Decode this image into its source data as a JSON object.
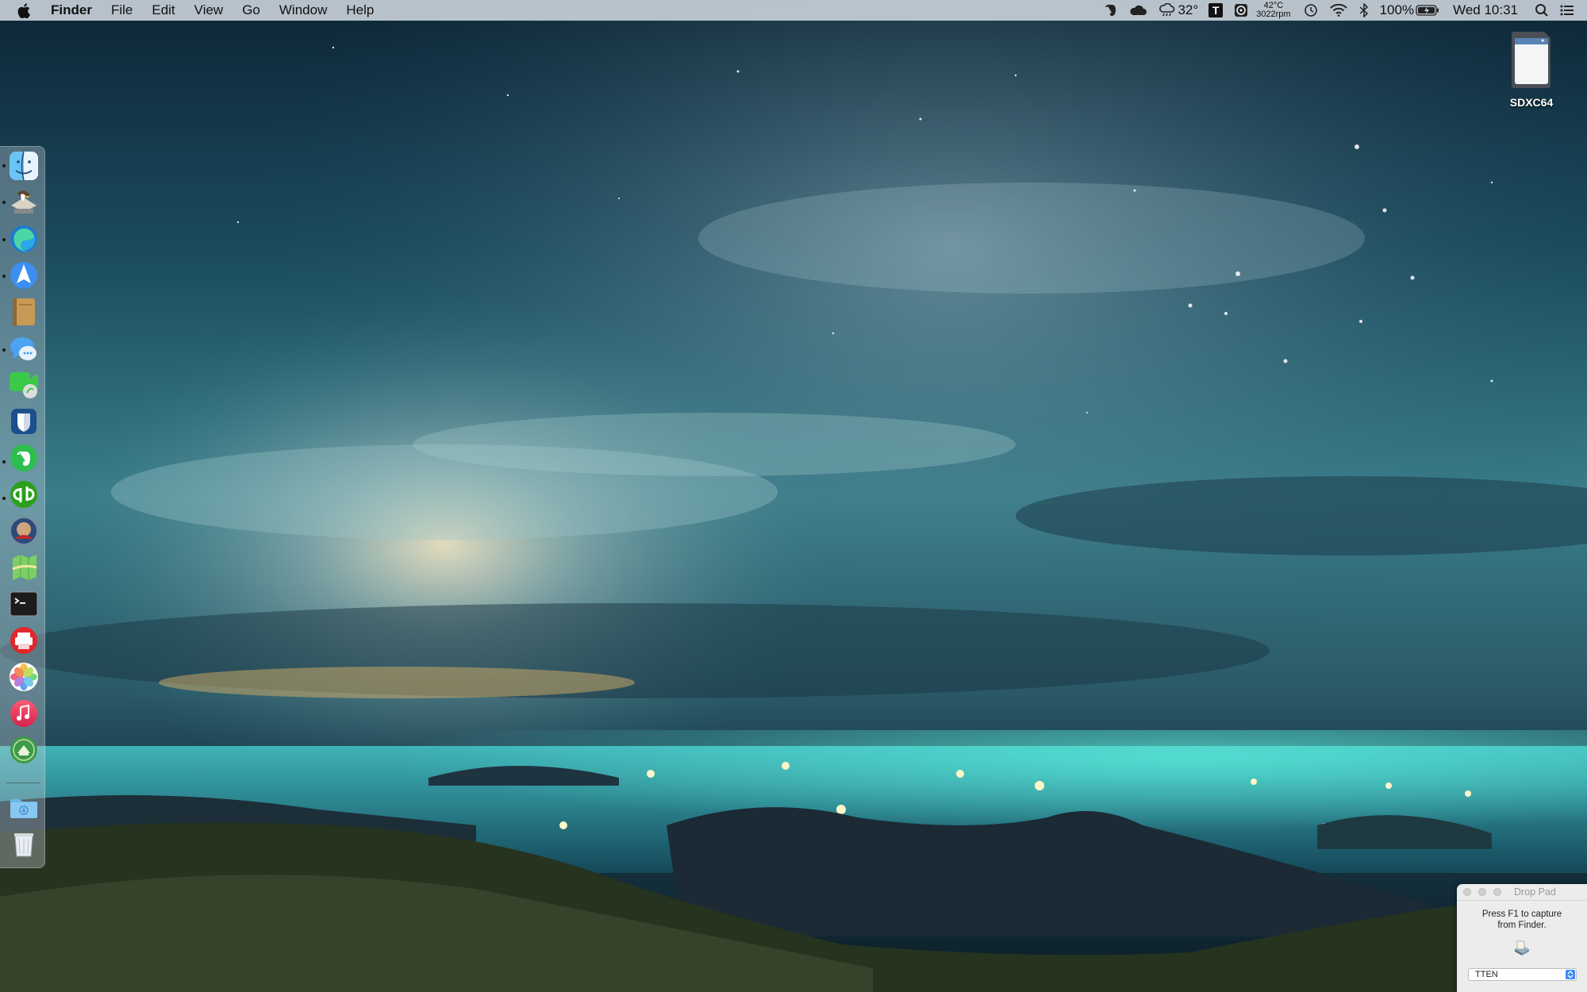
{
  "menubar": {
    "app_name": "Finder",
    "menus": [
      "File",
      "Edit",
      "View",
      "Go",
      "Window",
      "Help"
    ],
    "status": {
      "weather_temp": "32°",
      "cpu_temp": "42°C",
      "fan_speed": "3022rpm",
      "battery": "100%",
      "datetime": "Wed 10:31",
      "text_app_letter": "T"
    }
  },
  "dock": {
    "items": [
      {
        "name": "finder-icon",
        "running": true
      },
      {
        "name": "mail-eagle-icon",
        "running": true
      },
      {
        "name": "edge-icon",
        "running": true
      },
      {
        "name": "navigation-arrow-icon",
        "running": true
      },
      {
        "name": "notebook-icon",
        "running": false
      },
      {
        "name": "messages-icon",
        "running": true
      },
      {
        "name": "facetime-icon",
        "running": false
      },
      {
        "name": "bitwarden-icon",
        "running": false
      },
      {
        "name": "evernote-icon",
        "running": true
      },
      {
        "name": "quickbooks-icon",
        "running": true
      },
      {
        "name": "steam-avatar-icon",
        "running": false
      },
      {
        "name": "maps-icon",
        "running": false
      },
      {
        "name": "terminal-icon",
        "running": false
      },
      {
        "name": "printer-app-icon",
        "running": false
      },
      {
        "name": "photos-icon",
        "running": false
      },
      {
        "name": "music-icon",
        "running": false
      },
      {
        "name": "books-icon",
        "running": false
      }
    ],
    "downloads": "downloads-folder-icon",
    "trash": "trash-icon"
  },
  "desktop": {
    "sd_card_label": "SDXC64"
  },
  "droppad": {
    "title": "Drop Pad",
    "hint_line1": "Press F1 to capture",
    "hint_line2": "from Finder.",
    "selected": "TTEN"
  }
}
